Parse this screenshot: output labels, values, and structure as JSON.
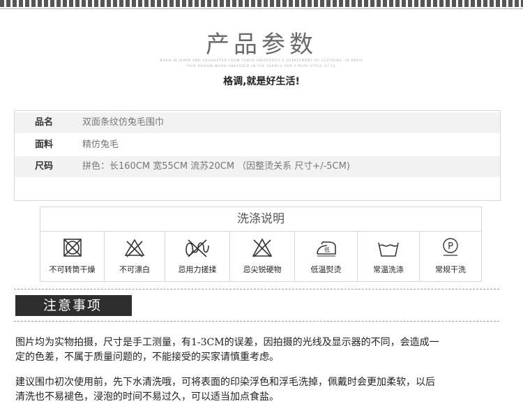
{
  "header": {
    "title": "产品参数",
    "sub_line1": "BORN IN JAPAN AND GRADUATED FROM TOKYO UNIVERSITY'S DEPARTMENT OF CLOTHING, IN PARIS",
    "sub_line2": "THIS DESIGN WORK OBSESSED IN THE SEARCH FOR A PURE STYLE OF CL",
    "tagline": "格调,就是好生活!"
  },
  "spec": {
    "rows": [
      {
        "key": "品名",
        "value": "双面条纹仿兔毛围巾"
      },
      {
        "key": "面料",
        "value": "精仿兔毛"
      },
      {
        "key": "尺码",
        "value": "拼色：长160CM  宽55CM  流苏20CM  （因整烫关系   尺寸+/-5CM)"
      }
    ]
  },
  "wash": {
    "title": "洗涤说明",
    "items": [
      {
        "label": "不可转筒干燥",
        "icon": "no-tumble-dry-icon"
      },
      {
        "label": "不可漂白",
        "icon": "no-bleach-icon"
      },
      {
        "label": "忌用力搓揉",
        "icon": "no-wring-icon"
      },
      {
        "label": "忌尖锐硬物",
        "icon": "no-sharp-objects-icon"
      },
      {
        "label": "低温熨烫",
        "icon": "low-iron-icon",
        "icon_text": "低"
      },
      {
        "label": "常温洗涤",
        "icon": "normal-wash-icon"
      },
      {
        "label": "常规干洗",
        "icon": "dry-clean-icon",
        "icon_text": "P"
      }
    ]
  },
  "notice": {
    "title": "注意事项",
    "para1_line1": "图片均为实物拍摄，尺寸是手工测量，有1-3CM的误差，因拍摄的光线及显示器的不同，会造成一",
    "para1_line2": "定的色差，不属于质量问题的，不能接受的买家请慎重考虑。",
    "para2_line1": "建议围巾初次使用前，先下水清洗哦，可将表面的印染浮色和浮毛洗掉，佩戴时会更加柔软，以后",
    "para2_line2": "清洗也不易褪色，浸泡的时间不易过久，可以适当加点食盐。"
  }
}
